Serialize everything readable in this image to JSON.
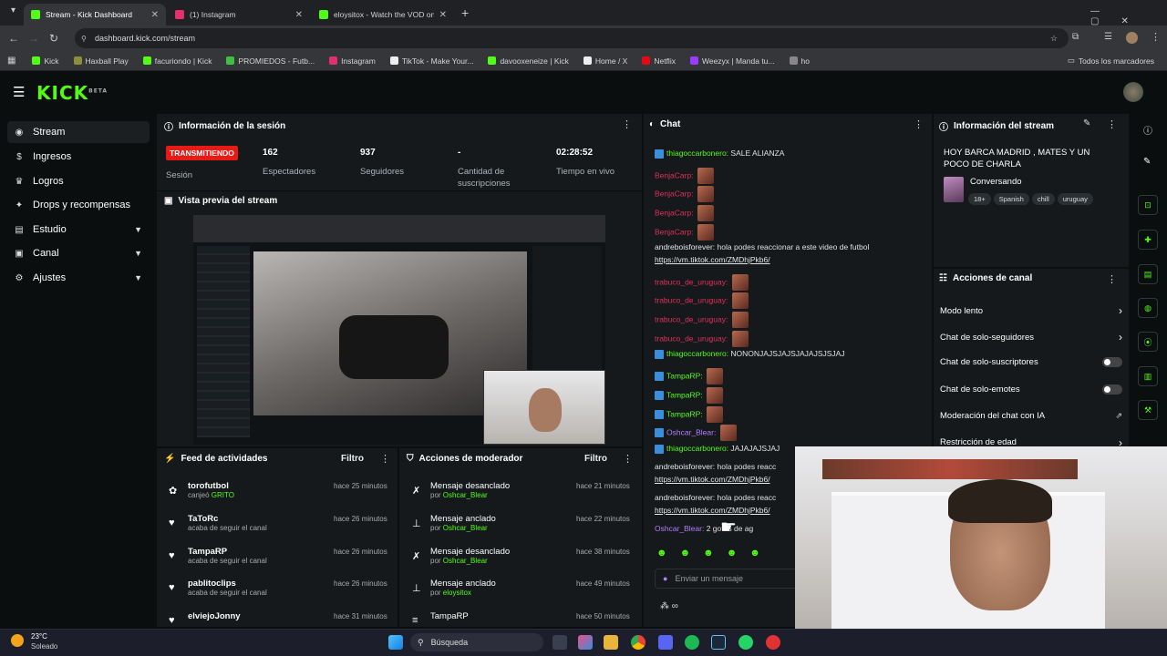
{
  "browser": {
    "tabs": [
      {
        "label": "Stream - Kick Dashboard",
        "color": "#53fc18"
      },
      {
        "label": "(1) Instagram",
        "color": "#e1306c"
      },
      {
        "label": "eloysitox - Watch the VOD on Ki",
        "color": "#53fc18"
      }
    ],
    "new_tab": "+",
    "url": "dashboard.kick.com/stream",
    "bookmarks": [
      {
        "label": "Kick",
        "color": "#53fc18"
      },
      {
        "label": "Haxball Play",
        "color": "#8e8e3a"
      },
      {
        "label": "facuriondo | Kick",
        "color": "#53fc18"
      },
      {
        "label": "PROMIEDOS - Futb...",
        "color": "#3fbf3f"
      },
      {
        "label": "Instagram",
        "color": "#e1306c"
      },
      {
        "label": "TikTok - Make Your...",
        "color": "#eeeeee"
      },
      {
        "label": "davooxeneize | Kick",
        "color": "#53fc18"
      },
      {
        "label": "Home / X",
        "color": "#eeeeee"
      },
      {
        "label": "Netflix",
        "color": "#e50914"
      },
      {
        "label": "Weezyx | Manda tu...",
        "color": "#9b3bff"
      },
      {
        "label": "ho",
        "color": "#888888"
      }
    ],
    "all_bookmarks": "Todos los marcadores"
  },
  "kick": {
    "logo": "KICK",
    "logo_sup": "BETA"
  },
  "sidebar": [
    {
      "label": "Stream",
      "icon": "circle-dot-icon",
      "glyph": "◉",
      "active": true,
      "chev": ""
    },
    {
      "label": "Ingresos",
      "icon": "money-icon",
      "glyph": "$",
      "active": false,
      "chev": ""
    },
    {
      "label": "Logros",
      "icon": "trophy-icon",
      "glyph": "♛",
      "active": false,
      "chev": ""
    },
    {
      "label": "Drops y recompensas",
      "icon": "gift-icon",
      "glyph": "✦",
      "active": false,
      "chev": ""
    },
    {
      "label": "Estudio",
      "icon": "studio-icon",
      "glyph": "▤",
      "active": false,
      "chev": "▼"
    },
    {
      "label": "Canal",
      "icon": "channel-icon",
      "glyph": "▣",
      "active": false,
      "chev": "▼"
    },
    {
      "label": "Ajustes",
      "icon": "gear-icon",
      "glyph": "⚙",
      "active": false,
      "chev": "▼"
    }
  ],
  "session": {
    "title": "Información de la sesión",
    "live_badge": "TRANSMITIENDO",
    "session_label": "Sesión",
    "viewers": "162",
    "viewers_label": "Espectadores",
    "followers": "937",
    "followers_label": "Seguidores",
    "subs": "-",
    "subs_label": "Cantidad de suscripciones",
    "uptime": "02:28:52",
    "uptime_label": "Tiempo en vivo"
  },
  "preview": {
    "title": "Vista previa del stream"
  },
  "feed": {
    "title": "Feed de actividades",
    "filter": "Filtro",
    "items": [
      {
        "name": "torofutbol",
        "sub": "canjeó ",
        "sub_hl": "GRITO",
        "time": "hace 25 minutos",
        "icon": "gift-icon",
        "glyph": "✿"
      },
      {
        "name": "TaToRc",
        "sub": "acaba de seguir el canal",
        "sub_hl": "",
        "time": "hace 26 minutos",
        "icon": "heart-icon",
        "glyph": "♥"
      },
      {
        "name": "TampaRP",
        "sub": "acaba de seguir el canal",
        "sub_hl": "",
        "time": "hace 26 minutos",
        "icon": "heart-icon",
        "glyph": "♥"
      },
      {
        "name": "pablitoclips",
        "sub": "acaba de seguir el canal",
        "sub_hl": "",
        "time": "hace 26 minutos",
        "icon": "heart-icon",
        "glyph": "♥"
      },
      {
        "name": "elviejoJonny",
        "sub": "",
        "sub_hl": "",
        "time": "hace 31 minutos",
        "icon": "heart-icon",
        "glyph": "♥"
      }
    ]
  },
  "mod": {
    "title": "Acciones de moderador",
    "filter": "Filtro",
    "items": [
      {
        "action": "Mensaje desanclado",
        "by": "por ",
        "user": "Oshcar_Blear",
        "time": "hace 21 minutos",
        "icon": "unpin-icon",
        "glyph": "✗"
      },
      {
        "action": "Mensaje anclado",
        "by": "por ",
        "user": "Oshcar_Blear",
        "time": "hace 22 minutos",
        "icon": "pin-icon",
        "glyph": "⊥"
      },
      {
        "action": "Mensaje desanclado",
        "by": "por ",
        "user": "Oshcar_Blear",
        "time": "hace 38 minutos",
        "icon": "unpin-icon",
        "glyph": "✗"
      },
      {
        "action": "Mensaje anclado",
        "by": "por ",
        "user": "eloysitox",
        "time": "hace 49 minutos",
        "icon": "pin-icon",
        "glyph": "⊥"
      },
      {
        "action": "TampaRP",
        "by": "",
        "user": "",
        "time": "hace 50 minutos",
        "icon": "list-icon",
        "glyph": "≡"
      }
    ]
  },
  "chat": {
    "title": "Chat",
    "lines": [
      {
        "user": "thiagoccarbonero:",
        "color": "#53fc18",
        "badge": true,
        "text": "SALE ALIANZA",
        "emotes": 0,
        "link": false
      },
      {
        "user": "BenjaCarp:",
        "color": "#e0305a",
        "badge": false,
        "text": "",
        "emotes": 1,
        "link": false
      },
      {
        "user": "BenjaCarp:",
        "color": "#e0305a",
        "badge": false,
        "text": "",
        "emotes": 1,
        "link": false
      },
      {
        "user": "BenjaCarp:",
        "color": "#e0305a",
        "badge": false,
        "text": "",
        "emotes": 1,
        "link": false
      },
      {
        "user": "BenjaCarp:",
        "color": "#e0305a",
        "badge": false,
        "text": "",
        "emotes": 1,
        "link": false
      },
      {
        "user": "andreboisforever:",
        "color": "#e6e6e6",
        "badge": false,
        "text": "hola podes reaccionar a este video de futbol",
        "emotes": 0,
        "link": false
      },
      {
        "user": "",
        "color": "#e6e6e6",
        "badge": false,
        "text": "https://vm.tiktok.com/ZMDhjPkb6/",
        "emotes": 0,
        "link": true
      },
      {
        "user": "trabuco_de_uruguay:",
        "color": "#e0305a",
        "badge": false,
        "text": "",
        "emotes": 1,
        "link": false
      },
      {
        "user": "trabuco_de_uruguay:",
        "color": "#e0305a",
        "badge": false,
        "text": "",
        "emotes": 1,
        "link": false
      },
      {
        "user": "trabuco_de_uruguay:",
        "color": "#e0305a",
        "badge": false,
        "text": "",
        "emotes": 1,
        "link": false
      },
      {
        "user": "trabuco_de_uruguay:",
        "color": "#e0305a",
        "badge": false,
        "text": "",
        "emotes": 1,
        "link": false
      },
      {
        "user": "thiagoccarbonero:",
        "color": "#53fc18",
        "badge": true,
        "text": "NONONJAJSJAJSJAJAJSJSJAJ",
        "emotes": 0,
        "link": false
      },
      {
        "user": "TampaRP:",
        "color": "#53fc18",
        "badge": true,
        "text": "",
        "emotes": 1,
        "link": false
      },
      {
        "user": "TampaRP:",
        "color": "#53fc18",
        "badge": true,
        "text": "",
        "emotes": 1,
        "link": false
      },
      {
        "user": "TampaRP:",
        "color": "#53fc18",
        "badge": true,
        "text": "",
        "emotes": 1,
        "link": false
      },
      {
        "user": "Oshcar_Blear:",
        "color": "#b57cff",
        "badge": true,
        "text": "",
        "emotes": 1,
        "link": false
      },
      {
        "user": "thiagoccarbonero:",
        "color": "#53fc18",
        "badge": true,
        "text": "JAJAJAJSJAJ",
        "emotes": 0,
        "link": false
      },
      {
        "user": "andreboisforever:",
        "color": "#e6e6e6",
        "badge": false,
        "text": "hola podes reacc",
        "emotes": 0,
        "link": false
      },
      {
        "user": "",
        "color": "#e6e6e6",
        "badge": false,
        "text": "https://vm.tiktok.com/ZMDhjPkb6/",
        "emotes": 0,
        "link": true
      },
      {
        "user": "andreboisforever:",
        "color": "#e6e6e6",
        "badge": false,
        "text": "hola podes reacc",
        "emotes": 0,
        "link": false
      },
      {
        "user": "",
        "color": "#e6e6e6",
        "badge": false,
        "text": "https://vm.tiktok.com/ZMDhjPkb6/",
        "emotes": 0,
        "link": true
      },
      {
        "user": "Oshcar_Blear:",
        "color": "#b57cff",
        "badge": false,
        "text": "2 gotas de ag",
        "emotes": 0,
        "link": false
      }
    ],
    "input_placeholder": "Enviar un mensaje"
  },
  "stream_info": {
    "title": "Información del stream",
    "stream_title": "HOY BARCA MADRID , MATES Y UN POCO DE CHARLA",
    "category": "Conversando",
    "tags": [
      "18+",
      "Spanish",
      "chill",
      "uruguay"
    ]
  },
  "channel_actions": {
    "title": "Acciones de canal",
    "items": [
      {
        "label": "Modo lento",
        "control": "arrow"
      },
      {
        "label": "Chat de solo-seguidores",
        "control": "arrow"
      },
      {
        "label": "Chat de solo-suscriptores",
        "control": "toggle"
      },
      {
        "label": "Chat de solo-emotes",
        "control": "toggle"
      },
      {
        "label": "Moderación del chat con IA",
        "control": "external"
      },
      {
        "label": "Restricción de edad",
        "control": "arrow"
      }
    ]
  },
  "taskbar": {
    "temp": "23°C",
    "weather": "Soleado",
    "search": "Búsqueda"
  }
}
